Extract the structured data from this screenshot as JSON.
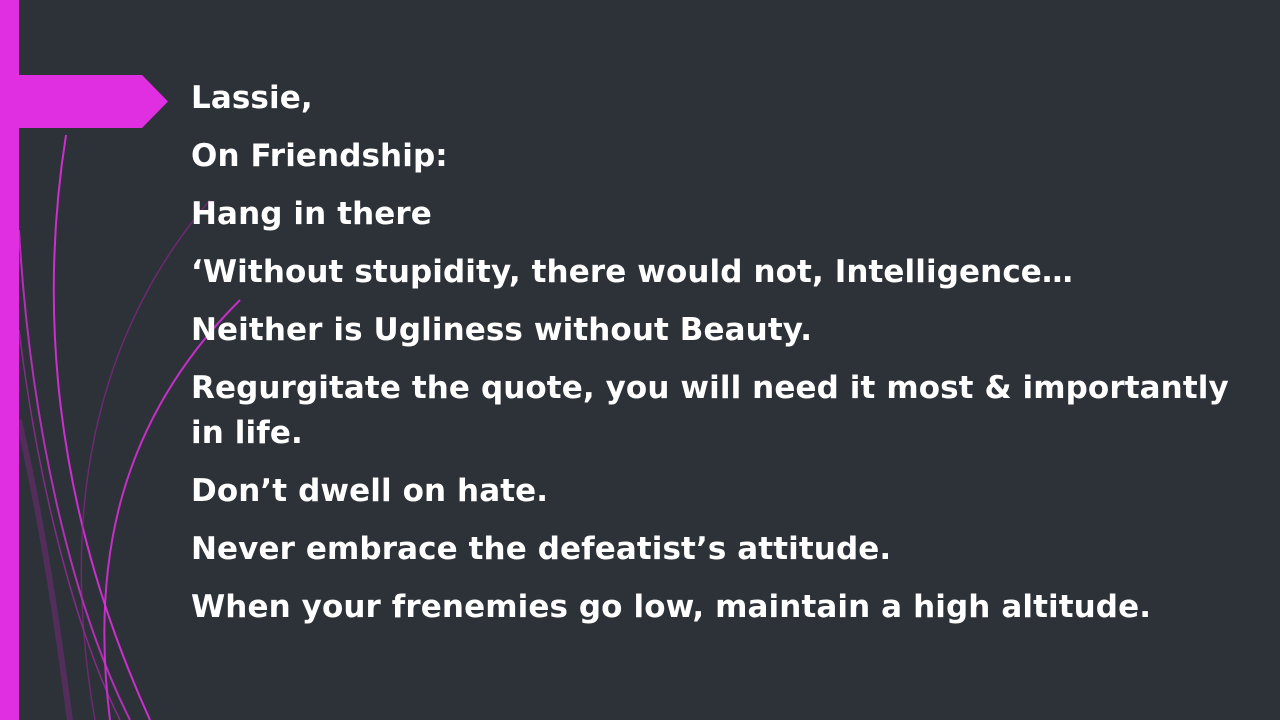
{
  "colors": {
    "background": "#2d3138",
    "accent": "#e02fe0",
    "text": "#ffffff"
  },
  "slide": {
    "lines": [
      "Lassie,",
      "On Friendship:",
      "Hang in there",
      "‘Without stupidity, there would not, Intelligence…",
      "Neither is Ugliness without Beauty.",
      "Regurgitate the quote, you will need it most & importantly in life.",
      "Don’t dwell on hate.",
      "Never embrace the defeatist’s attitude.",
      "When your frenemies go low, maintain a high altitude."
    ]
  }
}
